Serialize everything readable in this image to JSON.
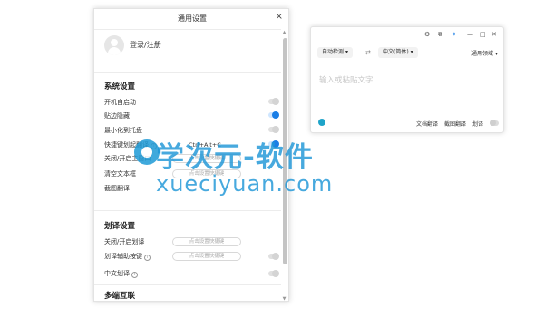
{
  "settings_window": {
    "title": "通用设置",
    "close_glyph": "×",
    "login_text": "登录/注册",
    "system_section": {
      "title": "系统设置",
      "rows": [
        {
          "label": "开机自启动",
          "toggle": "off"
        },
        {
          "label": "贴边隐藏",
          "toggle": "on"
        },
        {
          "label": "最小化到托盘",
          "toggle": "off"
        },
        {
          "label": "快捷键划起翻译",
          "info": true,
          "key_value": "Ctrl+Alt+C",
          "toggle": "on"
        },
        {
          "label": "关闭/开启主窗口",
          "key_placeholder": "点击设置快捷键"
        },
        {
          "label": "清空文本框",
          "key_placeholder": "点击设置快捷键"
        },
        {
          "label": "截图翻译"
        }
      ]
    },
    "select_section": {
      "title": "划译设置",
      "rows": [
        {
          "label": "关闭/开启划译",
          "key_placeholder": "点击设置快捷键"
        },
        {
          "label": "划译辅助按键",
          "info": true,
          "key_placeholder": "点击设置快捷键",
          "toggle": "off"
        },
        {
          "label": "中文划译",
          "info": true,
          "toggle": "off"
        }
      ]
    },
    "sync_section": {
      "title": "多端互联"
    },
    "info_glyph": "i",
    "scroll_up_glyph": "▲",
    "scroll_down_glyph": "▼"
  },
  "translator_window": {
    "controls": {
      "settings_icon": "gear-icon",
      "settings_glyph": "⚙",
      "screenshot_glyph": "⧉",
      "pin_glyph": "✦",
      "minimize_glyph": "—",
      "maximize_glyph": "□",
      "close_glyph": "✕"
    },
    "source_lang": "自动检测",
    "swap_glyph": "⇄",
    "target_lang": "中文(简体)",
    "dropdown_glyph": "▾",
    "domain_label": "通用领域",
    "input_placeholder": "输入或粘贴文字",
    "footer": {
      "doc_translate": "文档翻译",
      "screenshot_translate": "截图翻译",
      "select_translate": "划译"
    }
  },
  "watermark": {
    "main": "学次元-软件",
    "sub": "xueciyuan.com"
  },
  "colors": {
    "accent": "#1a7ee6",
    "watermark": "#1e96d7"
  }
}
